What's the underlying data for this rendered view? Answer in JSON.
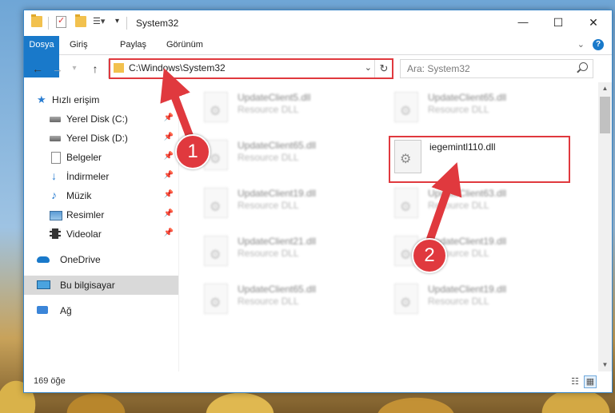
{
  "window": {
    "title": "System32",
    "minimize": "—",
    "maximize": "☐",
    "close": "✕"
  },
  "ribbon": {
    "tabs": [
      "Dosya",
      "Giriş",
      "Paylaş",
      "Görünüm"
    ],
    "help": "?"
  },
  "nav": {
    "back": "←",
    "forward": "→",
    "recent": "▾",
    "up": "↑",
    "address": "C:\\Windows\\System32",
    "refresh": "↻",
    "search_placeholder": "Ara: System32"
  },
  "sidebar": {
    "items": [
      {
        "label": "Hızlı erişim",
        "icon": "star-icon"
      },
      {
        "label": "Yerel Disk (C:)",
        "icon": "disk-icon",
        "pinned": true
      },
      {
        "label": "Yerel Disk (D:)",
        "icon": "disk-icon",
        "pinned": true
      },
      {
        "label": "Belgeler",
        "icon": "documents-icon",
        "pinned": true
      },
      {
        "label": "İndirmeler",
        "icon": "download-icon",
        "pinned": true
      },
      {
        "label": "Müzik",
        "icon": "music-icon",
        "pinned": true
      },
      {
        "label": "Resimler",
        "icon": "pictures-icon",
        "pinned": true
      },
      {
        "label": "Videolar",
        "icon": "video-icon",
        "pinned": true
      },
      {
        "label": "OneDrive",
        "icon": "cloud-icon"
      },
      {
        "label": "Bu bilgisayar",
        "icon": "computer-icon",
        "selected": true
      },
      {
        "label": "Ağ",
        "icon": "network-icon"
      }
    ]
  },
  "files": [
    {
      "name": "UpdateClient5.dll",
      "type": "Resource DLL"
    },
    {
      "name": "UpdateClient65.dll",
      "type": "Resource DLL"
    },
    {
      "name": "UpdateClient65.dll",
      "type": "Resource DLL"
    },
    {
      "name": "iegemintl110.dll",
      "type": ""
    },
    {
      "name": "UpdateClient19.dll",
      "type": "Resource DLL"
    },
    {
      "name": "UpdateClient63.dll",
      "type": "Resource DLL"
    },
    {
      "name": "UpdateClient21.dll",
      "type": "Resource DLL"
    },
    {
      "name": "UpdateClient19.dll",
      "type": "Resource DLL"
    },
    {
      "name": "UpdateClient65.dll",
      "type": "Resource DLL"
    },
    {
      "name": "UpdateClient19.dll",
      "type": "Resource DLL"
    }
  ],
  "status": {
    "count": "169 öğe"
  },
  "annotations": {
    "callout_1": "1",
    "callout_2": "2",
    "color": "#e0393e"
  }
}
